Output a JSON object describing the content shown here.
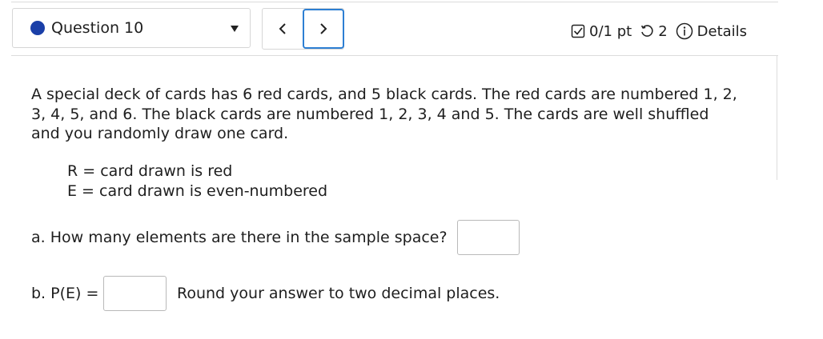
{
  "header": {
    "question_label": "Question 10",
    "score": "0/1 pt",
    "attempts": "2",
    "details_label": "Details"
  },
  "icons": {
    "status_dot": "status-dot-icon",
    "dropdown": "chevron-down-icon",
    "prev": "chevron-left-icon",
    "next": "chevron-right-icon",
    "score": "checkbox-icon",
    "attempts": "retry-icon",
    "details": "info-icon"
  },
  "colors": {
    "status_dot": "#1a3fa8",
    "focus_ring": "#2d7fd3"
  },
  "problem": {
    "line1": "A special deck of cards has 6 red cards, and 5 black cards. The red cards are numbered 1, 2,",
    "line2": "3, 4, 5, and 6. The black cards are numbered 1, 2, 3, 4 and 5. The cards are well shuffled",
    "line3": "and you randomly draw one card."
  },
  "definitions": {
    "r": "R = card drawn is red",
    "e": "E = card drawn is even-numbered"
  },
  "parts": {
    "a_prompt": "a. How many elements are there in the sample space?",
    "a_value": "",
    "b_prompt": "b. P(E) =",
    "b_value": "",
    "b_hint": "Round your answer to two decimal places."
  }
}
